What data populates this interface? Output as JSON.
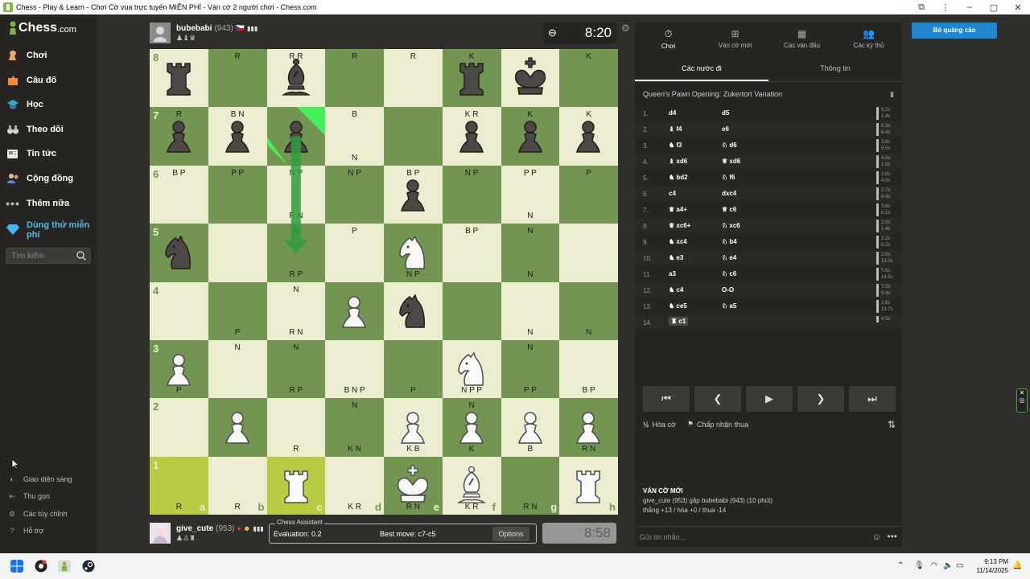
{
  "window": {
    "title": "Chess - Play & Learn - Chơi Cờ vua trực tuyến MIỄN PHÍ - Ván cờ 2 người chơi - Chess.com"
  },
  "sidebar": {
    "logo": "Chess",
    "logo_suffix": ".com",
    "items": [
      {
        "label": "Chơi",
        "icon": "play-pawn-icon"
      },
      {
        "label": "Câu đố",
        "icon": "puzzle-icon"
      },
      {
        "label": "Học",
        "icon": "learn-icon"
      },
      {
        "label": "Theo dõi",
        "icon": "binoculars-icon"
      },
      {
        "label": "Tin tức",
        "icon": "news-icon"
      },
      {
        "label": "Cộng đồng",
        "icon": "community-icon"
      },
      {
        "label": "Thêm nữa",
        "icon": "more-dots-icon"
      },
      {
        "label": "Dùng thử miễn phí",
        "icon": "diamond-icon"
      }
    ],
    "search_placeholder": "Tìm kiếm",
    "bottom": [
      {
        "label": "Giao diện sáng",
        "icon": "theme-icon"
      },
      {
        "label": "Thu gọn",
        "icon": "collapse-icon"
      },
      {
        "label": "Các tùy chỉnh",
        "icon": "settings-icon"
      },
      {
        "label": "Hỗ trợ",
        "icon": "help-icon"
      }
    ]
  },
  "top_player": {
    "name": "bubebabi",
    "rating": "(943)",
    "captured": "♟♝♛",
    "clock": "8:20"
  },
  "bottom_player": {
    "name": "give_cute",
    "rating": "(953)",
    "captured": "♟♙♜",
    "clock": "8:58"
  },
  "board": {
    "files": [
      "a",
      "b",
      "c",
      "d",
      "e",
      "f",
      "g",
      "h"
    ],
    "ranks": [
      "8",
      "7",
      "6",
      "5",
      "4",
      "3",
      "2",
      "1"
    ],
    "pieces": [
      {
        "sq": "a8",
        "p": "br"
      },
      {
        "sq": "c8",
        "p": "bb"
      },
      {
        "sq": "f8",
        "p": "br"
      },
      {
        "sq": "g8",
        "p": "bk"
      },
      {
        "sq": "a7",
        "p": "bp"
      },
      {
        "sq": "b7",
        "p": "bp"
      },
      {
        "sq": "c7",
        "p": "bp"
      },
      {
        "sq": "f7",
        "p": "bp"
      },
      {
        "sq": "g7",
        "p": "bp"
      },
      {
        "sq": "h7",
        "p": "bp"
      },
      {
        "sq": "e6",
        "p": "bp"
      },
      {
        "sq": "a5",
        "p": "bn"
      },
      {
        "sq": "e5",
        "p": "wn"
      },
      {
        "sq": "d4",
        "p": "wp"
      },
      {
        "sq": "e4",
        "p": "bn"
      },
      {
        "sq": "a3",
        "p": "wp"
      },
      {
        "sq": "f3",
        "p": "wn"
      },
      {
        "sq": "b2",
        "p": "wp"
      },
      {
        "sq": "e2",
        "p": "wp"
      },
      {
        "sq": "f2",
        "p": "wp"
      },
      {
        "sq": "g2",
        "p": "wp"
      },
      {
        "sq": "h2",
        "p": "wp"
      },
      {
        "sq": "c1",
        "p": "wr"
      },
      {
        "sq": "e1",
        "p": "wk"
      },
      {
        "sq": "f1",
        "p": "wb"
      },
      {
        "sq": "h1",
        "p": "wr"
      }
    ],
    "highlights": [
      "a1",
      "c1"
    ],
    "annotations": [
      {
        "sq": "b8",
        "pos": "tc",
        "t": "R"
      },
      {
        "sq": "c8",
        "pos": "tc",
        "t": "R R"
      },
      {
        "sq": "d8",
        "pos": "tc",
        "t": "R"
      },
      {
        "sq": "e8",
        "pos": "tc",
        "t": "R"
      },
      {
        "sq": "f8",
        "pos": "tc",
        "t": "K"
      },
      {
        "sq": "h8",
        "pos": "tc",
        "t": "K"
      },
      {
        "sq": "a7",
        "pos": "tc",
        "t": "R"
      },
      {
        "sq": "b7",
        "pos": "tc",
        "t": "B N"
      },
      {
        "sq": "d7",
        "pos": "tc",
        "t": "B"
      },
      {
        "sq": "d7",
        "pos": "bc",
        "t": "N"
      },
      {
        "sq": "f7",
        "pos": "tc",
        "t": "K R"
      },
      {
        "sq": "g7",
        "pos": "tc",
        "t": "K"
      },
      {
        "sq": "h7",
        "pos": "tc",
        "t": "K"
      },
      {
        "sq": "a6",
        "pos": "tc",
        "t": "B P"
      },
      {
        "sq": "b6",
        "pos": "tc",
        "t": "P P"
      },
      {
        "sq": "c6",
        "pos": "tc",
        "t": "N P"
      },
      {
        "sq": "c6",
        "pos": "bc",
        "t": "R N"
      },
      {
        "sq": "d6",
        "pos": "tc",
        "t": "N P"
      },
      {
        "sq": "e6",
        "pos": "tc",
        "t": "B P"
      },
      {
        "sq": "f6",
        "pos": "tc",
        "t": "N P"
      },
      {
        "sq": "g6",
        "pos": "tc",
        "t": "P P"
      },
      {
        "sq": "g6",
        "pos": "bc",
        "t": "N"
      },
      {
        "sq": "h6",
        "pos": "tc",
        "t": "P"
      },
      {
        "sq": "c5",
        "pos": "tc",
        "t": "N"
      },
      {
        "sq": "d5",
        "pos": "tc",
        "t": "P"
      },
      {
        "sq": "e5",
        "pos": "bc",
        "t": "N P"
      },
      {
        "sq": "f5",
        "pos": "tc",
        "t": "B P"
      },
      {
        "sq": "g5",
        "pos": "tc",
        "t": "N"
      },
      {
        "sq": "g5",
        "pos": "bc",
        "t": "N"
      },
      {
        "sq": "c5",
        "pos": "bc",
        "t": "R P"
      },
      {
        "sq": "c4",
        "pos": "tc",
        "t": "N"
      },
      {
        "sq": "b4",
        "pos": "bc",
        "t": "P"
      },
      {
        "sq": "c4",
        "pos": "bc",
        "t": "R N"
      },
      {
        "sq": "g4",
        "pos": "bc",
        "t": "N"
      },
      {
        "sq": "h4",
        "pos": "bc",
        "t": "N"
      },
      {
        "sq": "b3",
        "pos": "tc",
        "t": "N"
      },
      {
        "sq": "c3",
        "pos": "tc",
        "t": "N"
      },
      {
        "sq": "g3",
        "pos": "tc",
        "t": "N"
      },
      {
        "sq": "a3",
        "pos": "bc",
        "t": "P"
      },
      {
        "sq": "c3",
        "pos": "bc",
        "t": "R P"
      },
      {
        "sq": "d3",
        "pos": "bc",
        "t": "B N P"
      },
      {
        "sq": "e3",
        "pos": "bc",
        "t": "P"
      },
      {
        "sq": "f3",
        "pos": "bc",
        "t": "N P P"
      },
      {
        "sq": "g3",
        "pos": "bc",
        "t": "P P"
      },
      {
        "sq": "h3",
        "pos": "bc",
        "t": "B P"
      },
      {
        "sq": "d2",
        "pos": "tc",
        "t": "N"
      },
      {
        "sq": "f2",
        "pos": "tc",
        "t": "N"
      },
      {
        "sq": "c2",
        "pos": "bc",
        "t": "R"
      },
      {
        "sq": "d2",
        "pos": "bc",
        "t": "K N"
      },
      {
        "sq": "e2",
        "pos": "bc",
        "t": "K B"
      },
      {
        "sq": "f2",
        "pos": "bc",
        "t": "K"
      },
      {
        "sq": "g2",
        "pos": "bc",
        "t": "B"
      },
      {
        "sq": "h2",
        "pos": "bc",
        "t": "R N"
      },
      {
        "sq": "a1",
        "pos": "bc",
        "t": "R"
      },
      {
        "sq": "b1",
        "pos": "bc",
        "t": "R"
      },
      {
        "sq": "d1",
        "pos": "bc",
        "t": "K R"
      },
      {
        "sq": "e1",
        "pos": "bc",
        "t": "R N"
      },
      {
        "sq": "f1",
        "pos": "bc",
        "t": "K R"
      },
      {
        "sq": "g1",
        "pos": "bc",
        "t": "R N"
      }
    ],
    "arrow": {
      "from": "c7",
      "to": "c5",
      "color": "#2f9e3e"
    },
    "corner_marks": [
      "c7-tl",
      "c7-tr"
    ]
  },
  "assistant": {
    "title": "Chess Assistant",
    "evaluation": "Evaluation: 0.2",
    "best_move": "Best move: c7-c5",
    "options_label": "Options"
  },
  "panel": {
    "tabs": [
      {
        "label": "Chơi",
        "icon": "stopwatch-icon",
        "active": true
      },
      {
        "label": "Ván cờ mới",
        "icon": "plus-board-icon",
        "active": false
      },
      {
        "label": "Các ván đấu",
        "icon": "games-grid-icon",
        "active": false
      },
      {
        "label": "Các kỳ thủ",
        "icon": "players-icon",
        "active": false
      }
    ],
    "subtabs": [
      {
        "label": "Các nước đi",
        "active": true
      },
      {
        "label": "Thông tin",
        "active": false
      }
    ],
    "opening": "Queen's Pawn Opening: Zukertort Variation",
    "moves": [
      {
        "n": "1.",
        "w": "d4",
        "b": "d5",
        "t1": "9.2s",
        "t2": "1.4s"
      },
      {
        "n": "2.",
        "w": "♝ f4",
        "b": "e6",
        "t1": "6.2s",
        "t2": "6.4s"
      },
      {
        "n": "3.",
        "w": "♞ f3",
        "b": "♘ d6",
        "t1": "3.9s",
        "t2": "9.5s"
      },
      {
        "n": "4.",
        "w": "♝ xd6",
        "b": "♕ xd6",
        "t1": "4.9s",
        "t2": "1.5s"
      },
      {
        "n": "5.",
        "w": "♞ bd2",
        "b": "♘ f6",
        "t1": "2.8s",
        "t2": "4.0s"
      },
      {
        "n": "6.",
        "w": "c4",
        "b": "dxc4",
        "t1": "2.7s",
        "t2": "8.4s"
      },
      {
        "n": "7.",
        "w": "♛ a4+",
        "b": "♕ c6",
        "t1": "3.6s",
        "t2": "6.1s"
      },
      {
        "n": "8.",
        "w": "♛ xc6+",
        "b": "♘ xc6",
        "t1": "2.8s",
        "t2": "1.4s"
      },
      {
        "n": "9.",
        "w": "♞ xc4",
        "b": "♘ b4",
        "t1": "2.2s",
        "t2": "6.2s"
      },
      {
        "n": "10.",
        "w": "♞ e3",
        "b": "♘ e4",
        "t1": "2.6s",
        "t2": "13.0s"
      },
      {
        "n": "11.",
        "w": "a3",
        "b": "♘ c6",
        "t1": "5.6s",
        "t2": "14.5s"
      },
      {
        "n": "12.",
        "w": "♞ c4",
        "b": "O-O",
        "t1": "7.5s",
        "t2": "9.4s"
      },
      {
        "n": "13.",
        "w": "♞ ce5",
        "b": "♘ a5",
        "t1": "2.6s",
        "t2": "13.7s"
      },
      {
        "n": "14.",
        "w": "♜ c1",
        "b": "",
        "t1": "4.5s",
        "t2": ""
      }
    ],
    "controls": [
      "first-move-icon",
      "prev-move-icon",
      "play-icon",
      "next-move-icon",
      "last-move-icon"
    ],
    "draw_label": "Hòa cờ",
    "resign_label": "Chấp nhận thua",
    "newgame_title": "VÁN CỜ MỚI",
    "newgame_line1": "give_cute (953) gặp bubebabi (943) (10 phút)",
    "newgame_line2": "thắng +13 / hòa +0 / thua -14",
    "chat_placeholder": "Gửi tin nhắn..."
  },
  "ads_button": "Bỏ quảng cáo",
  "taskbar": {
    "time": "9:13 PM",
    "date": "11/14/2025"
  }
}
